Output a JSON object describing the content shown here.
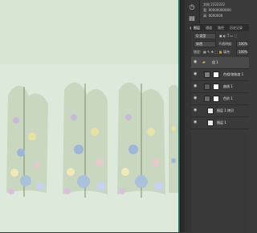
{
  "canvas": {
    "background": "#dfeadc",
    "accent": "#2f6b5a"
  },
  "properties": {
    "line1": "文档 2222222",
    "line2": "宽: 00000000000",
    "line3": "高: 0000000"
  },
  "layers_panel": {
    "tabs": [
      "图层",
      "通道",
      "路径",
      "历史记录"
    ],
    "kind_label": "Q 类型",
    "blend_mode": "穿透",
    "opacity_label": "不透明度:",
    "opacity_value": "100%",
    "lock_label": "锁定:",
    "fill_label": "填充:",
    "fill_value": "100%",
    "layers": [
      {
        "name": "组 1",
        "type": "group"
      },
      {
        "name": "色相/饱和度 1",
        "type": "adjustment"
      },
      {
        "name": "曲线 1",
        "type": "adjustment"
      },
      {
        "name": "色阶 1",
        "type": "adjustment"
      },
      {
        "name": "图层 1 拷贝",
        "type": "image"
      },
      {
        "name": "图层 1",
        "type": "image"
      }
    ]
  }
}
